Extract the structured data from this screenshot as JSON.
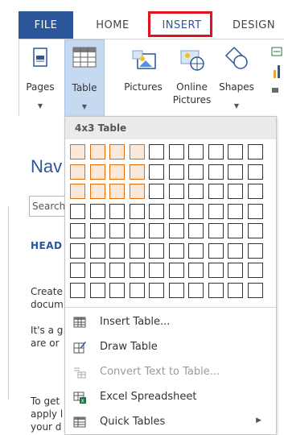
{
  "tabs": {
    "file": "FILE",
    "home": "HOME",
    "insert": "INSERT",
    "design": "DESIGN"
  },
  "ribbon": {
    "pages": "Pages",
    "table": "Table",
    "pictures": "Pictures",
    "online_pictures_1": "Online",
    "online_pictures_2": "Pictures",
    "shapes": "Shapes"
  },
  "navigation": {
    "title": "Nav",
    "search_placeholder": "Search",
    "headings": "HEAD",
    "lines": [
      "Create",
      "docum",
      "It's a g",
      "are or",
      "To get",
      "apply l",
      "your d"
    ]
  },
  "table_dropdown": {
    "header": "4x3 Table",
    "grid_cols": 10,
    "grid_rows": 8,
    "selected_cols": 4,
    "selected_rows": 3,
    "accent": "#e46c0a",
    "items": [
      {
        "label": "Insert Table...",
        "icon": "insert-table-icon",
        "disabled": false
      },
      {
        "label": "Draw Table",
        "icon": "draw-table-icon",
        "disabled": false
      },
      {
        "label": "Convert Text to Table...",
        "icon": "convert-text-icon",
        "disabled": true
      },
      {
        "label": "Excel Spreadsheet",
        "icon": "excel-spreadsheet-icon",
        "disabled": false
      },
      {
        "label": "Quick Tables",
        "icon": "quick-tables-icon",
        "disabled": false,
        "submenu": true
      }
    ]
  },
  "colors": {
    "brand": "#2b579a",
    "highlight_box": "#e3101e",
    "table_button_bg": "#c5d9f1"
  }
}
